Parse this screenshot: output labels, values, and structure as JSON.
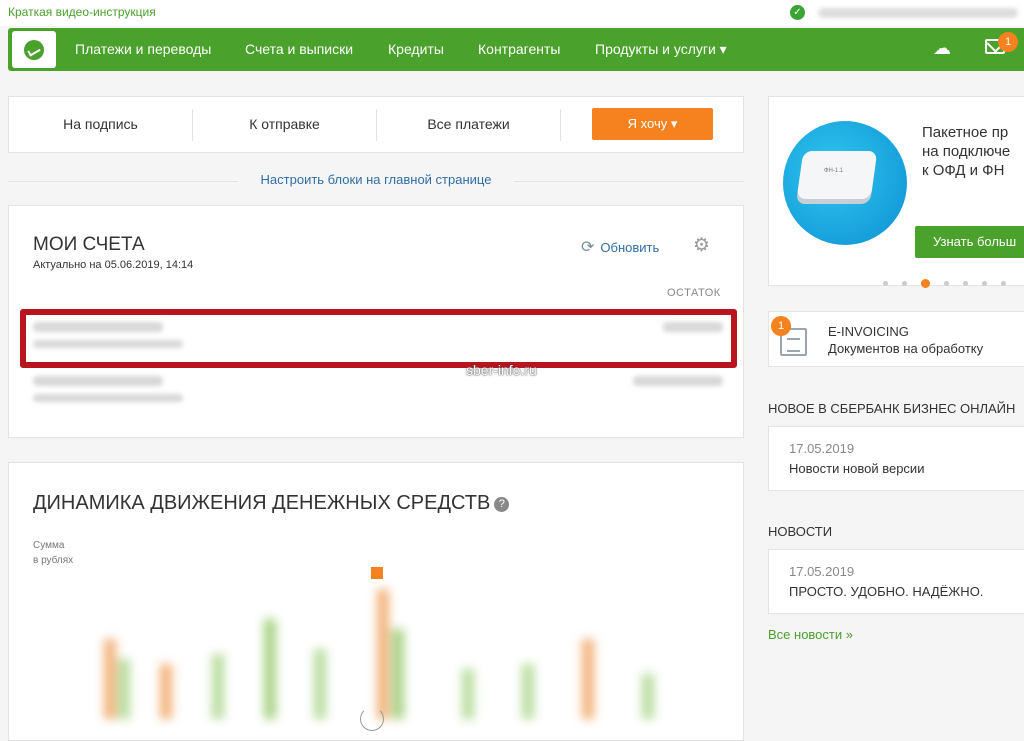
{
  "topbar": {
    "video_link": "Краткая видео-инструкция"
  },
  "nav": {
    "items": [
      {
        "label": "Платежи и переводы"
      },
      {
        "label": "Счета и выписки"
      },
      {
        "label": "Кредиты"
      },
      {
        "label": "Контрагенты"
      },
      {
        "label": "Продукты и услуги ▾"
      }
    ],
    "mail_badge": "1",
    "accent": "#4aa12c"
  },
  "payment_tabs": {
    "tabs": [
      {
        "label": "На подпись"
      },
      {
        "label": "К отправке"
      },
      {
        "label": "Все платежи"
      }
    ],
    "want_button": "Я хочу ▾"
  },
  "configure_link": "Настроить блоки на главной странице",
  "accounts": {
    "title": "МОИ СЧЕТА",
    "actual": "Актуально на 05.06.2019, 14:14",
    "refresh": "Обновить",
    "balance_header": "ОСТАТОК"
  },
  "watermark": "sber-info.ru",
  "cashflow": {
    "title": "ДИНАМИКА ДВИЖЕНИЯ ДЕНЕЖНЫХ СРЕДСТВ",
    "help": "?",
    "sum_label_1": "Сумма",
    "sum_label_2": "в рублях"
  },
  "promo": {
    "line1": "Пакетное пр",
    "line2": "на подключе",
    "line3": "к ОФД и ФН",
    "button": "Узнать больш",
    "box_label": "ФН-1.1"
  },
  "einvoicing": {
    "badge": "1",
    "name": "E-INVOICING",
    "sub": "Документов на обработку"
  },
  "news_sbbol": {
    "heading": "НОВОЕ В СБЕРБАНК БИЗНЕС ОНЛАЙН",
    "date": "17.05.2019",
    "title": "Новости новой версии"
  },
  "news": {
    "heading": "НОВОСТИ",
    "date": "17.05.2019",
    "title": "ПРОСТО. УДОБНО. НАДЁЖНО.",
    "all": "Все новости »"
  },
  "colors": {
    "green": "#4aa12c",
    "orange": "#f5821f",
    "link": "#2f6ea6",
    "highlight": "#b8151e"
  }
}
